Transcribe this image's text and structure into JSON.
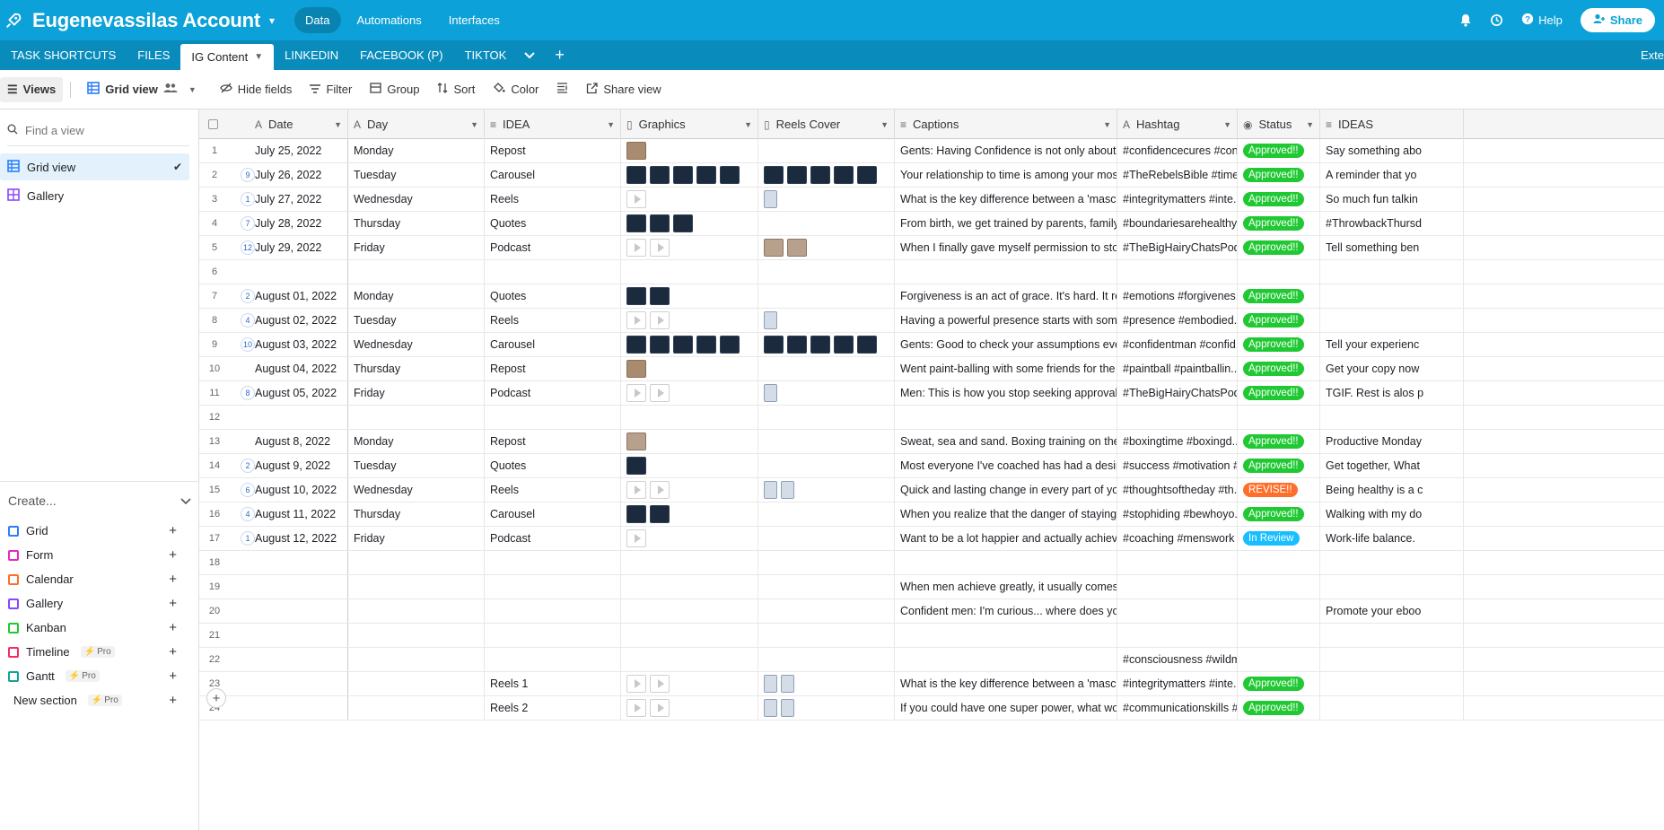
{
  "topbar": {
    "base_name": "Eugenevassilas Account",
    "nav": [
      "Data",
      "Automations",
      "Interfaces"
    ],
    "help_label": "Help",
    "share_label": "Share"
  },
  "tabs": {
    "items": [
      "TASK SHORTCUTS",
      "FILES",
      "IG Content",
      "LINKEDIN",
      "FACEBOOK (P)",
      "TIKTOK"
    ],
    "active_index": 2,
    "extensions_label": "Exte"
  },
  "toolbar": {
    "views_label": "Views",
    "view_name": "Grid view",
    "hide_fields": "Hide fields",
    "filter": "Filter",
    "group": "Group",
    "sort": "Sort",
    "color": "Color",
    "share_view": "Share view"
  },
  "sidebar": {
    "find_placeholder": "Find a view",
    "views": [
      {
        "label": "Grid view",
        "active": true
      },
      {
        "label": "Gallery",
        "active": false
      }
    ],
    "create_label": "Create...",
    "create_items": [
      {
        "label": "Grid",
        "color": "#2d7ff9",
        "pro": false
      },
      {
        "label": "Form",
        "color": "#e929ba",
        "pro": false
      },
      {
        "label": "Calendar",
        "color": "#ff6f2c",
        "pro": false
      },
      {
        "label": "Gallery",
        "color": "#8b46ff",
        "pro": false
      },
      {
        "label": "Kanban",
        "color": "#20c933",
        "pro": false
      },
      {
        "label": "Timeline",
        "color": "#f82b60",
        "pro": true
      },
      {
        "label": "Gantt",
        "color": "#0fa697",
        "pro": true
      },
      {
        "label": "New section",
        "color": "",
        "pro": true
      }
    ],
    "pro_label": "Pro"
  },
  "columns": [
    {
      "label": "Date",
      "icon": "text-icon"
    },
    {
      "label": "Day",
      "icon": "text-icon"
    },
    {
      "label": "IDEA",
      "icon": "long-text-icon"
    },
    {
      "label": "Graphics",
      "icon": "attachment-icon"
    },
    {
      "label": "Reels Cover",
      "icon": "attachment-icon"
    },
    {
      "label": "Captions",
      "icon": "long-text-icon"
    },
    {
      "label": "Hashtag",
      "icon": "text-icon"
    },
    {
      "label": "Status",
      "icon": "single-select-icon"
    },
    {
      "label": "IDEAS",
      "icon": "long-text-icon"
    }
  ],
  "status_colors": {
    "Approved!!": "#20c933",
    "REVISE!!": "#ff6f2c",
    "In Review": "#18bfff"
  },
  "rows": [
    {
      "n": "1",
      "c": "",
      "date": "July 25, 2022",
      "day": "Monday",
      "idea": "Repost",
      "g": "lt:1",
      "rc": "",
      "cap": "Gents: Having Confidence is not only about yo...",
      "tag": "#confidencecures #con...",
      "status": "Approved!!",
      "ideas": "Say something abo"
    },
    {
      "n": "2",
      "c": "9",
      "date": "July 26, 2022",
      "day": "Tuesday",
      "idea": "Carousel",
      "g": "dk:5",
      "rc": "dk:5",
      "cap": "Your relationship to time is among your most i...",
      "tag": "#TheRebelsBible #time ...",
      "status": "Approved!!",
      "ideas": "A reminder that yo"
    },
    {
      "n": "3",
      "c": "1",
      "date": "July 27, 2022",
      "day": "Wednesday",
      "idea": "Reels",
      "g": "play:1",
      "rc": "face:1",
      "cap": "What is the key difference between a 'masculin...",
      "tag": "#integritymatters #inte...",
      "status": "Approved!!",
      "ideas": "So much fun talkin"
    },
    {
      "n": "4",
      "c": "7",
      "date": "July 28, 2022",
      "day": "Thursday",
      "idea": "Quotes",
      "g": "dk:3",
      "rc": "",
      "cap": "From birth, we get trained by parents, family, fr...",
      "tag": "#boundariesarehealthy ...",
      "status": "Approved!!",
      "ideas": "#ThrowbackThursd"
    },
    {
      "n": "5",
      "c": "12",
      "date": "July 29, 2022",
      "day": "Friday",
      "idea": "Podcast",
      "g": "play:2",
      "rc": "pp:2",
      "cap": "When I finally gave myself permission to stop li...",
      "tag": "#TheBigHairyChatsPod...",
      "status": "Approved!!",
      "ideas": "Tell something ben"
    },
    {
      "n": "6",
      "c": "",
      "date": "",
      "day": "",
      "idea": "",
      "g": "",
      "rc": "",
      "cap": "",
      "tag": "",
      "status": "",
      "ideas": ""
    },
    {
      "n": "7",
      "c": "2",
      "date": "August 01, 2022",
      "day": "Monday",
      "idea": "Quotes",
      "g": "dk:2",
      "rc": "",
      "cap": "Forgiveness is an act of grace. It's hard. It requi...",
      "tag": "#emotions #forgivenes...",
      "status": "Approved!!",
      "ideas": ""
    },
    {
      "n": "8",
      "c": "4",
      "date": "August 02, 2022",
      "day": "Tuesday",
      "idea": "Reels",
      "g": "play:2",
      "rc": "face:1",
      "cap": "Having a powerful presence starts with some f...",
      "tag": "#presence #embodied...",
      "status": "Approved!!",
      "ideas": ""
    },
    {
      "n": "9",
      "c": "10",
      "date": "August 03, 2022",
      "day": "Wednesday",
      "idea": "Carousel",
      "g": "dk:5",
      "rc": "dk:5",
      "cap": "Gents: Good to check your assumptions every ...",
      "tag": "#confidentman #confid...",
      "status": "Approved!!",
      "ideas": "Tell your experienc"
    },
    {
      "n": "10",
      "c": "",
      "date": "August 04, 2022",
      "day": "Thursday",
      "idea": "Repost",
      "g": "lt:1",
      "rc": "",
      "cap": "Went paint-balling with some friends for the fir...",
      "tag": "#paintball #paintballin...",
      "status": "Approved!!",
      "ideas": "Get your copy now"
    },
    {
      "n": "11",
      "c": "8",
      "date": "August 05, 2022",
      "day": "Friday",
      "idea": "Podcast",
      "g": "play:2",
      "rc": "face:1",
      "cap": "Men: This is how you stop seeking approval an...",
      "tag": "#TheBigHairyChatsPod...",
      "status": "Approved!!",
      "ideas": "TGIF. Rest is alos p"
    },
    {
      "n": "12",
      "c": "",
      "date": "",
      "day": "",
      "idea": "",
      "g": "",
      "rc": "",
      "cap": "",
      "tag": "",
      "status": "",
      "ideas": ""
    },
    {
      "n": "13",
      "c": "",
      "date": "August 8, 2022",
      "day": "Monday",
      "idea": "Repost",
      "g": "pp:1",
      "rc": "",
      "cap": "Sweat, sea and sand. Boxing training on the be...",
      "tag": "#boxingtime #boxingd...",
      "status": "Approved!!",
      "ideas": "Productive Monday"
    },
    {
      "n": "14",
      "c": "2",
      "date": "August 9, 2022",
      "day": "Tuesday",
      "idea": "Quotes",
      "g": "dk:1",
      "rc": "",
      "cap": "Most everyone I've coached has had a desire f...",
      "tag": "#success #motivation #...",
      "status": "Approved!!",
      "ideas": "Get together, What"
    },
    {
      "n": "15",
      "c": "6",
      "date": "August 10, 2022",
      "day": "Wednesday",
      "idea": "Reels",
      "g": "play:2",
      "rc": "face:2",
      "cap": "Quick and lasting change in every part of your ...",
      "tag": "#thoughtsoftheday #th...",
      "status": "REVISE!!",
      "ideas": "Being healthy is a c"
    },
    {
      "n": "16",
      "c": "4",
      "date": "August 11, 2022",
      "day": "Thursday",
      "idea": "Carousel",
      "g": "dk:2",
      "rc": "",
      "cap": "When you realize that the danger of staying qu...",
      "tag": "#stophiding #bewhoyo...",
      "status": "Approved!!",
      "ideas": "Walking with my do"
    },
    {
      "n": "17",
      "c": "1",
      "date": "August 12, 2022",
      "day": "Friday",
      "idea": "Podcast",
      "g": "play:1",
      "rc": "",
      "cap": "Want to be a lot happier and actually achieving...",
      "tag": "#coaching #menswork ...",
      "status": "In Review",
      "ideas": "Work-life balance."
    },
    {
      "n": "18",
      "c": "",
      "date": "",
      "day": "",
      "idea": "",
      "g": "",
      "rc": "",
      "cap": "",
      "tag": "",
      "status": "",
      "ideas": ""
    },
    {
      "n": "19",
      "c": "",
      "date": "",
      "day": "",
      "idea": "",
      "g": "",
      "rc": "",
      "cap": "When men achieve greatly, it usually comes at ...",
      "tag": "",
      "status": "",
      "ideas": ""
    },
    {
      "n": "20",
      "c": "",
      "date": "",
      "day": "",
      "idea": "",
      "g": "",
      "rc": "",
      "cap": "Confident men: I'm curious... where does your ...",
      "tag": "",
      "status": "",
      "ideas": "Promote your eboo"
    },
    {
      "n": "21",
      "c": "",
      "date": "",
      "day": "",
      "idea": "",
      "g": "",
      "rc": "",
      "cap": "",
      "tag": "",
      "status": "",
      "ideas": ""
    },
    {
      "n": "22",
      "c": "",
      "date": "",
      "day": "",
      "idea": "",
      "g": "",
      "rc": "",
      "cap": "",
      "tag": "#consciousness #wildm...",
      "status": "",
      "ideas": ""
    },
    {
      "n": "23",
      "c": "",
      "date": "",
      "day": "",
      "idea": "Reels 1",
      "g": "play:2",
      "rc": "face:2",
      "cap": "What is the key difference between a 'masculin...",
      "tag": "#integritymatters #inte...",
      "status": "Approved!!",
      "ideas": ""
    },
    {
      "n": "24",
      "c": "",
      "date": "",
      "day": "",
      "idea": "Reels 2",
      "g": "play:2",
      "rc": "face:2",
      "cap": "If you could have one super power, what woul...",
      "tag": "#communicationskills #...",
      "status": "Approved!!",
      "ideas": ""
    }
  ]
}
